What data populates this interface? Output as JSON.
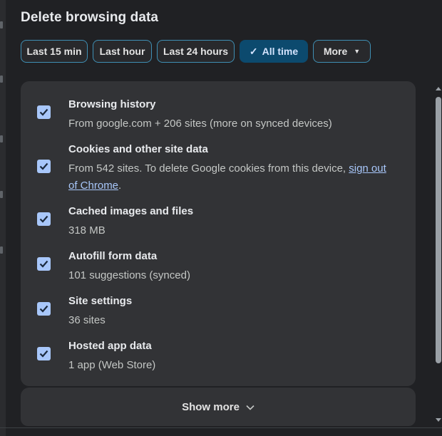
{
  "dialog": {
    "title": "Delete browsing data"
  },
  "time_range": {
    "options": [
      {
        "label": "Last 15 min",
        "selected": false
      },
      {
        "label": "Last hour",
        "selected": false
      },
      {
        "label": "Last 24 hours",
        "selected": false
      },
      {
        "label": "All time",
        "selected": true
      },
      {
        "label": "More",
        "selected": false
      }
    ]
  },
  "data_types": [
    {
      "title": "Browsing history",
      "description": "From google.com + 206 sites (more on synced devices)",
      "checked": true
    },
    {
      "title": "Cookies and other site data",
      "description": "From 542 sites. To delete Google cookies from this device,",
      "link_text": "sign out of Chrome",
      "description_end": ".",
      "checked": true
    },
    {
      "title": "Cached images and files",
      "description": "318 MB",
      "checked": true
    },
    {
      "title": "Autofill form data",
      "description": "101 suggestions (synced)",
      "checked": true
    },
    {
      "title": "Site settings",
      "description": "36 sites",
      "checked": true
    },
    {
      "title": "Hosted app data",
      "description": "1 app (Web Store)",
      "checked": true
    }
  ],
  "show_more_label": "Show more",
  "colors": {
    "accent": "#a8c7fa",
    "selected_chip": "#0c4a6e",
    "panel": "#323336",
    "background": "#202124"
  },
  "icons": {
    "checkbox": "checkmark-icon",
    "chip_check": "check-icon",
    "more": "caret-down-icon",
    "show_more": "chevron-down-icon"
  }
}
